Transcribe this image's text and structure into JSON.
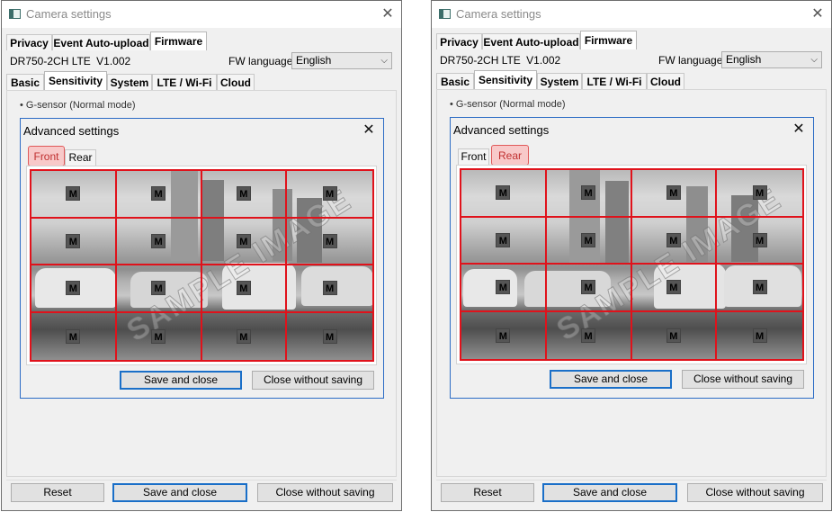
{
  "window": {
    "title": "Camera settings",
    "close_glyph": "✕"
  },
  "top_tabs": [
    "Privacy",
    "Event Auto-upload",
    "Firmware"
  ],
  "device": {
    "model": "DR750-2CH LTE",
    "version": "V1.002"
  },
  "fw_language": {
    "label": "FW language",
    "value": "English"
  },
  "section_tabs": [
    "Basic",
    "Sensitivity",
    "System",
    "LTE / Wi-Fi",
    "Cloud"
  ],
  "gsensor_label": "• G-sensor (Normal mode)",
  "dialog": {
    "title": "Advanced settings",
    "close_glyph": "✕",
    "tabs": [
      "Front",
      "Rear"
    ],
    "cell_marker": "M",
    "watermark": "SAMPLE IMAGE",
    "save_label": "Save and close",
    "cancel_label": "Close without saving"
  },
  "footer": {
    "reset_label": "Reset",
    "save_label": "Save and close",
    "cancel_label": "Close without saving"
  },
  "panels": [
    {
      "active_camera_tab": "Front"
    },
    {
      "active_camera_tab": "Rear"
    }
  ],
  "colors": {
    "grid_line": "#e0121b",
    "highlight_fill": "#f8c9c9",
    "highlight_border": "#e05a5a",
    "focus_border": "#1a6fc8",
    "dialog_border": "#2c6cc5"
  },
  "icons": {
    "app": "camera-settings-icon",
    "close": "close-icon",
    "dropdown": "chevron-down-icon",
    "marker": "motion-zone-marker"
  }
}
